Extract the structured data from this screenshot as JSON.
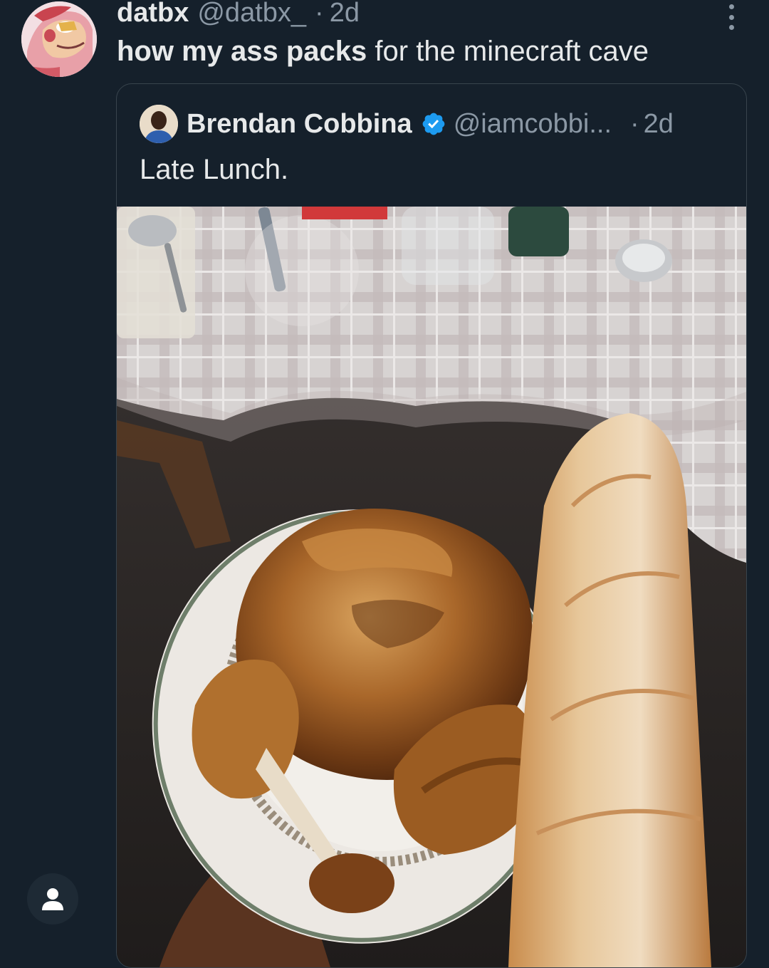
{
  "tweet": {
    "display_name": "datbx",
    "handle": "@datbx_",
    "separator": "·",
    "time": "2d",
    "text_bold": "how my ass packs",
    "text_rest": " for the minecraft cave"
  },
  "quote": {
    "display_name": "Brendan Cobbina",
    "verified": true,
    "handle": "@iamcobbi...",
    "separator": "·",
    "time": "2d",
    "text": "Late Lunch."
  },
  "icons": {
    "more": "more-vertical-icon",
    "verified": "verified-badge-icon",
    "account": "person-icon"
  },
  "colors": {
    "background": "#15202b",
    "text_primary": "#e7e9ea",
    "text_secondary": "#8b98a5",
    "verified_blue": "#1d9bf0",
    "border": "#38444d"
  }
}
